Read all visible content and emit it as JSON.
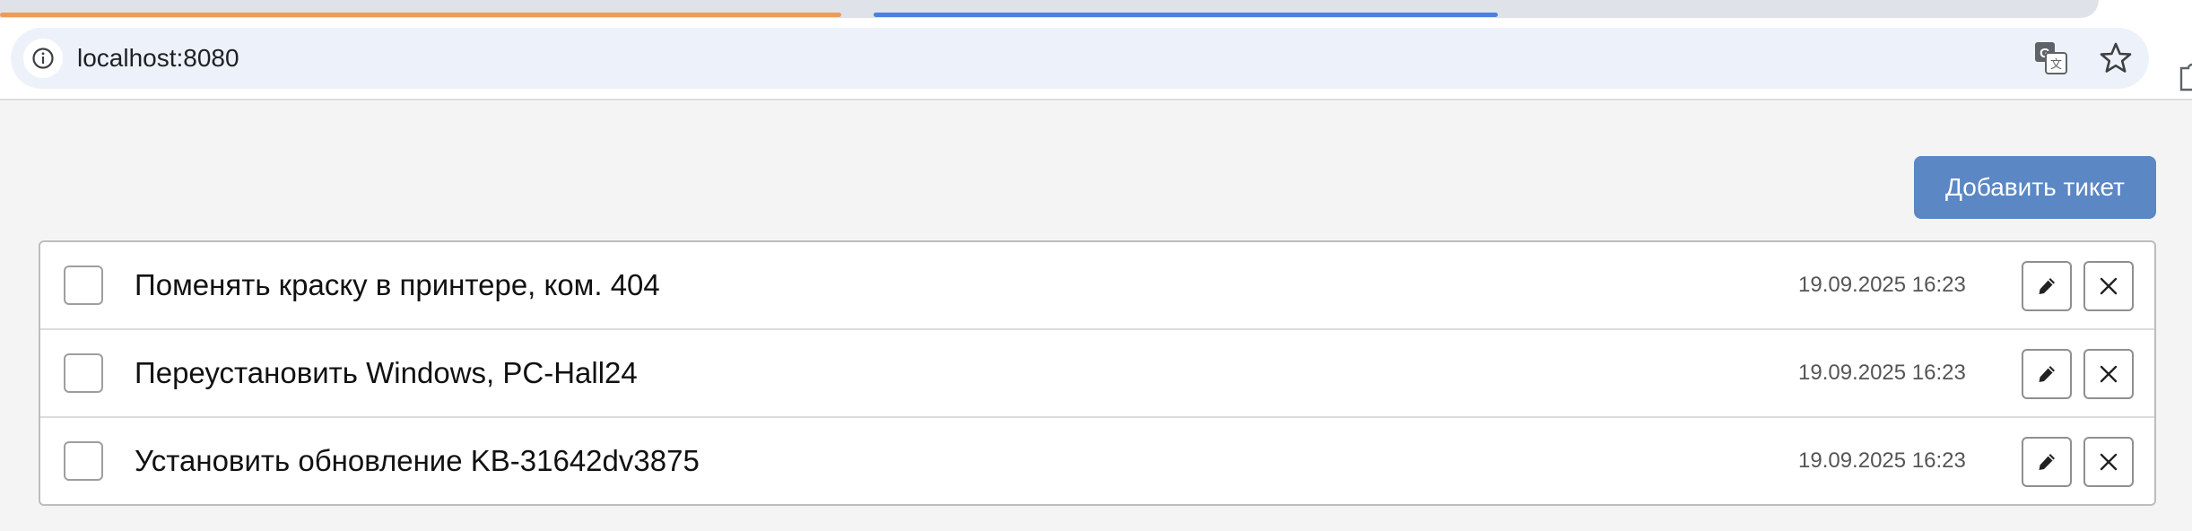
{
  "browser": {
    "url": "localhost:8080",
    "icons": {
      "info": "info-icon",
      "translate": "translate-icon",
      "bookmark": "star-icon",
      "extensions": "puzzle-icon"
    },
    "tab_colors": {
      "active_group": "#ef9a57",
      "second_group": "#4a80e2"
    }
  },
  "app": {
    "add_ticket_label": "Добавить тикет",
    "accent_color": "#5b87c4",
    "tickets": [
      {
        "title": "Поменять краску в принтере, ком. 404",
        "date": "19.09.2025 16:23",
        "done": false
      },
      {
        "title": "Переустановить Windows, PC-Hall24",
        "date": "19.09.2025 16:23",
        "done": false
      },
      {
        "title": "Установить обновление KB-31642dv3875",
        "date": "19.09.2025 16:23",
        "done": false
      }
    ],
    "row_icons": {
      "edit": "pencil-icon",
      "delete": "close-icon"
    }
  }
}
